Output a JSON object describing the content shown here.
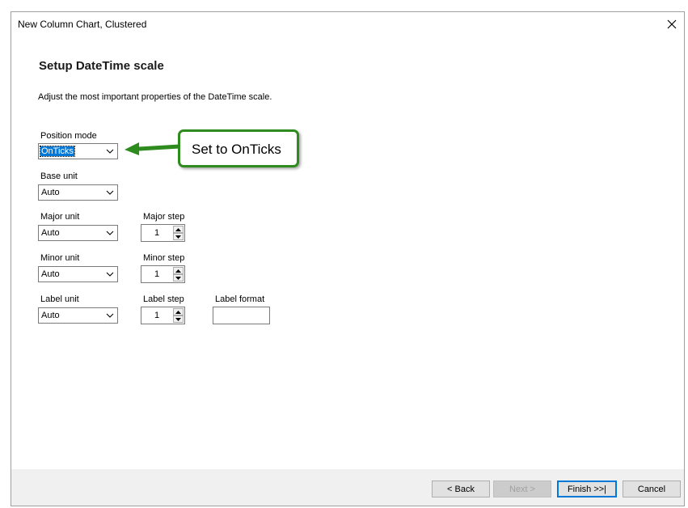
{
  "window": {
    "title": "New Column Chart, Clustered",
    "close_icon": "close-icon"
  },
  "page": {
    "heading": "Setup DateTime scale",
    "description": "Adjust the most important properties of the DateTime scale."
  },
  "fields": {
    "position_mode": {
      "label": "Position mode",
      "value": "OnTicks"
    },
    "base_unit": {
      "label": "Base unit",
      "value": "Auto"
    },
    "major_unit": {
      "label": "Major unit",
      "value": "Auto"
    },
    "major_step": {
      "label": "Major step",
      "value": "1"
    },
    "minor_unit": {
      "label": "Minor unit",
      "value": "Auto"
    },
    "minor_step": {
      "label": "Minor step",
      "value": "1"
    },
    "label_unit": {
      "label": "Label unit",
      "value": "Auto"
    },
    "label_step": {
      "label": "Label step",
      "value": "1"
    },
    "label_format": {
      "label": "Label format",
      "value": ""
    }
  },
  "annotation": {
    "text": "Set to OnTicks",
    "color": "#2e8b1e"
  },
  "buttons": {
    "back": "< Back",
    "next": "Next >",
    "finish": "Finish >>|",
    "cancel": "Cancel"
  },
  "colors": {
    "selection": "#0078d7",
    "footer": "#f0f0f0"
  }
}
